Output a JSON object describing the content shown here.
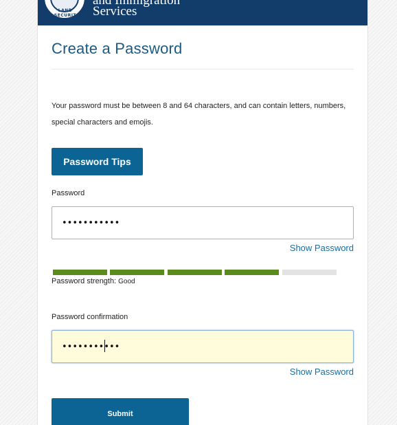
{
  "header": {
    "seal_text": "LAND SECURIT",
    "agency_line1": "and Immigration",
    "agency_line2": "Services",
    "bg_color": "#123d6b"
  },
  "form": {
    "title": "Create a Password",
    "intro": "Your password must be between 8 and 64 characters, and can contain letters, numbers, special characters and emojis.",
    "tips_button": "Password Tips",
    "password": {
      "label": "Password",
      "value": "•••••••••••",
      "show_label": "Show Password"
    },
    "strength": {
      "label": "Password strength:",
      "value": "Good",
      "filled_segments": 4,
      "total_segments": 5,
      "filled_color": "#5a8b1c",
      "empty_color": "#e3e3e3"
    },
    "confirmation": {
      "label": "Password confirmation",
      "value": "•••••••••••",
      "show_label": "Show Password",
      "focused": true
    },
    "submit_button": "Submit"
  },
  "colors": {
    "primary_button": "#0b6494",
    "title": "#1a5a85",
    "link": "#1a6ea0",
    "focused_field": "#fffcdb"
  },
  "icons": {
    "seal": "dhs-seal-icon"
  }
}
